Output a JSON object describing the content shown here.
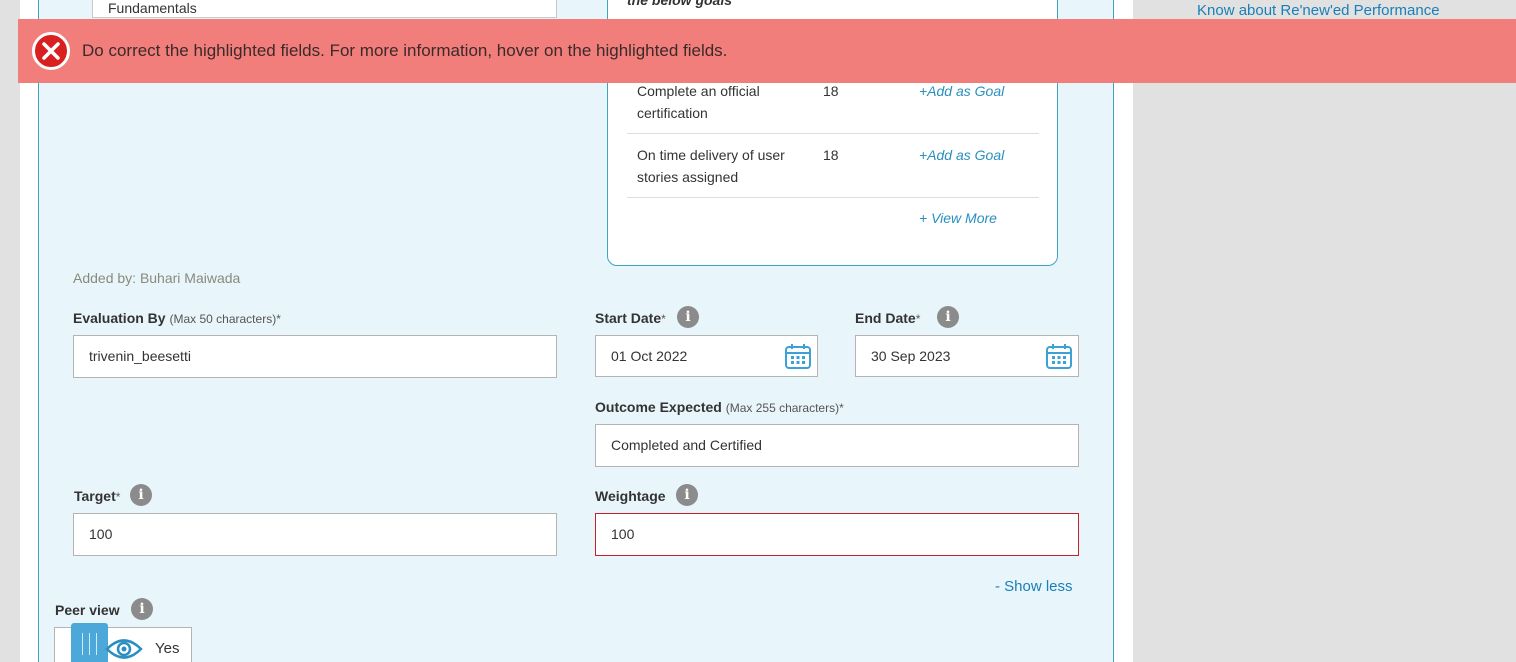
{
  "right_panel": {
    "link_label": "Know about Re'new'ed Performance"
  },
  "fundamentals": {
    "text": "Fundamentals"
  },
  "suggestions": {
    "heading": "the below goals",
    "rows": [
      {
        "name": "Complete an official certification",
        "count": "18",
        "action": "+Add as Goal"
      },
      {
        "name": "On time delivery of user stories assigned",
        "count": "18",
        "action": "+Add as Goal"
      }
    ],
    "view_more": "+ View More"
  },
  "error_banner": {
    "message": "Do correct the highlighted fields. For more information, hover on the highlighted fields.",
    "background": "#f27e7c",
    "icon": "close-circle-icon"
  },
  "added_by": "Added by: Buhari Maiwada",
  "form": {
    "evaluation_by": {
      "label": "Evaluation By",
      "hint": "(Max 50 characters)",
      "required": "*",
      "value": "trivenin_beesetti"
    },
    "start_date": {
      "label": "Start Date",
      "required": "*",
      "value": "01 Oct 2022"
    },
    "end_date": {
      "label": "End Date",
      "required": "*",
      "value": "30 Sep 2023"
    },
    "outcome_expected": {
      "label": "Outcome Expected",
      "hint": "(Max 255 characters)",
      "required": "*",
      "value": "Completed and Certified"
    },
    "target": {
      "label": "Target",
      "required": "*",
      "value": "100"
    },
    "weightage": {
      "label": "Weightage",
      "value": "100",
      "error_color": "#c8202a"
    },
    "show_less": "- Show less",
    "peer_view": {
      "label": "Peer view",
      "toggle_value": "Yes"
    }
  },
  "colors": {
    "accent": "#2a8fc0",
    "panel": "#e8f6fc",
    "info_icon": "#8b8b8b"
  }
}
